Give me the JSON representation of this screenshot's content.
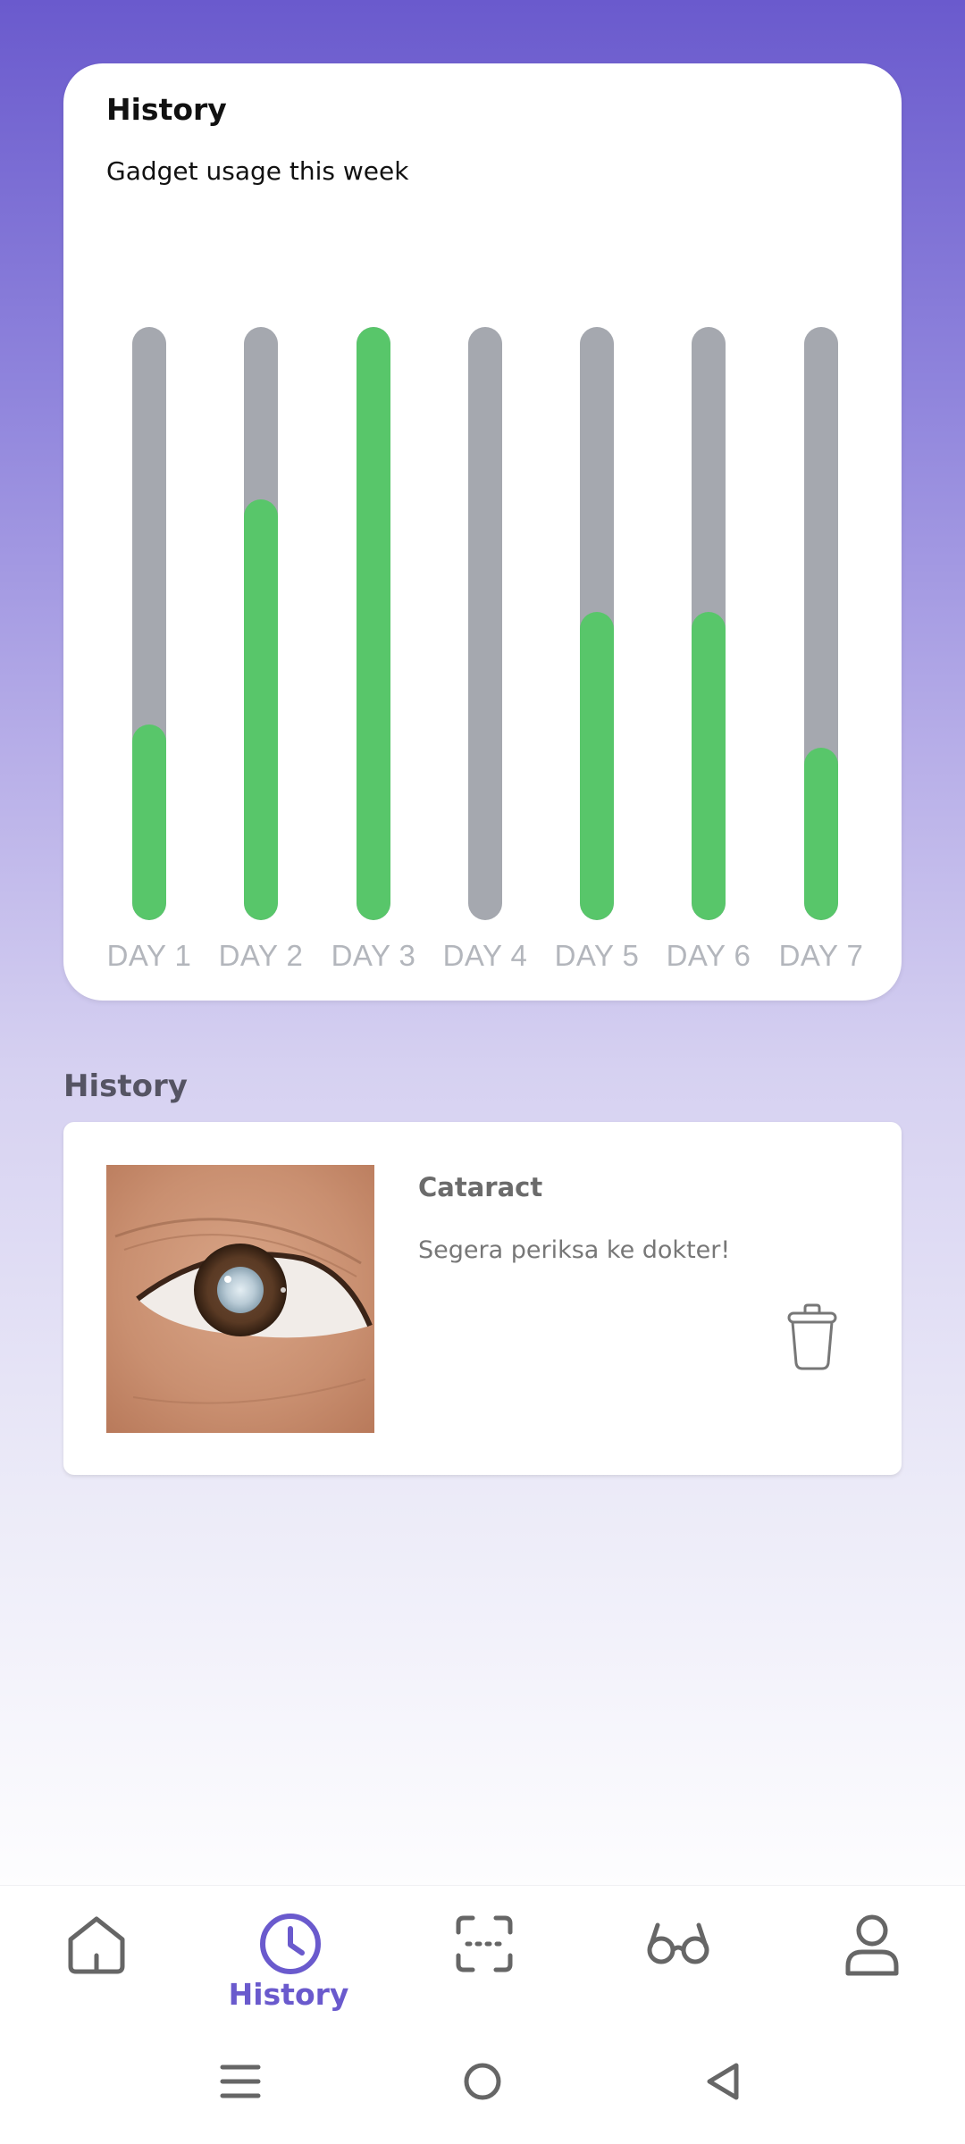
{
  "usage_card": {
    "title": "History",
    "subtitle": "Gadget usage this week"
  },
  "chart_data": {
    "type": "bar",
    "title": "Gadget usage this week",
    "categories": [
      "DAY 1",
      "DAY 2",
      "DAY 3",
      "DAY 4",
      "DAY 5",
      "DAY 6",
      "DAY 7"
    ],
    "values": [
      0.33,
      0.71,
      1.0,
      0.0,
      0.52,
      0.52,
      0.29
    ],
    "ylim": [
      0,
      1
    ],
    "colors": {
      "fill": "#58c66a",
      "track": "#a5a8af"
    }
  },
  "history_section": {
    "title": "History",
    "items": [
      {
        "name": "Cataract",
        "description": "Segera periksa ke dokter!",
        "delete_icon": "trash-icon"
      }
    ]
  },
  "bottom_nav": {
    "active_color": "#6a5acd",
    "items": [
      {
        "icon": "home-icon",
        "label": ""
      },
      {
        "icon": "clock-icon",
        "label": "History"
      },
      {
        "icon": "scan-icon",
        "label": ""
      },
      {
        "icon": "glasses-icon",
        "label": ""
      },
      {
        "icon": "user-icon",
        "label": ""
      }
    ]
  },
  "system_nav": {
    "items": [
      "menu-icon",
      "home-circle-icon",
      "back-icon"
    ]
  }
}
